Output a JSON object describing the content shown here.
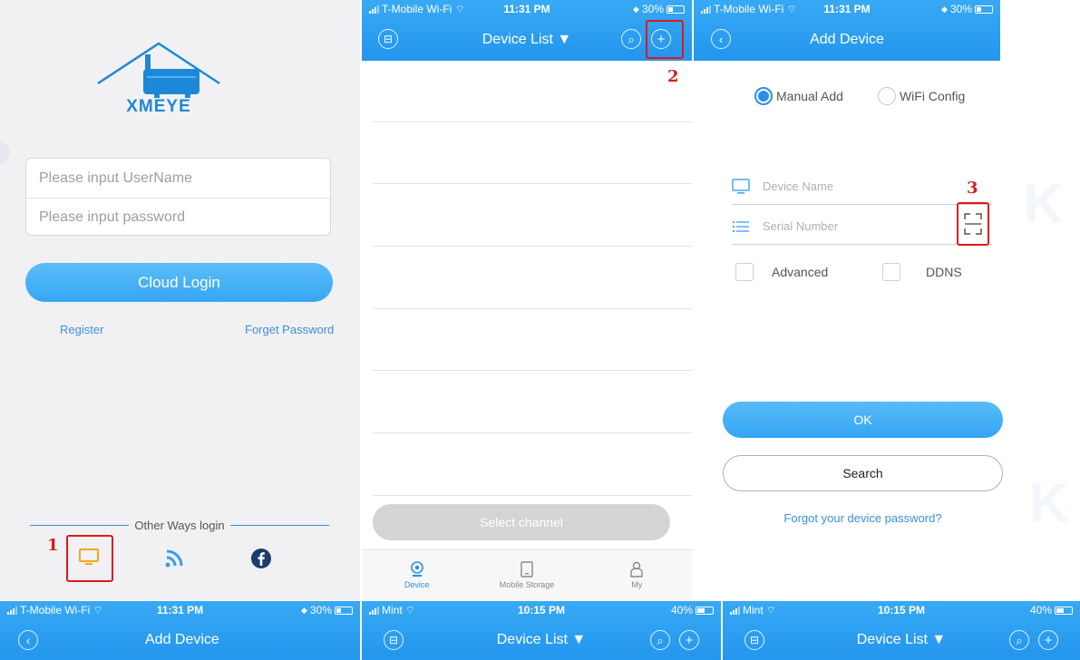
{
  "markers": {
    "one": "1",
    "two": "2",
    "three": "3"
  },
  "colors": {
    "brand_blue": "#2396ee",
    "link_blue": "#3c8fdc",
    "highlight_red": "#e01818"
  },
  "login": {
    "logo_text": "XMEYE",
    "username_placeholder": "Please input UserName",
    "password_placeholder": "Please input password",
    "cloud_login": "Cloud Login",
    "register": "Register",
    "forget_password": "Forget Password",
    "other_ways": "Other Ways login",
    "other_icons": [
      "local-device-icon",
      "wifi-signal-icon",
      "facebook-icon"
    ]
  },
  "device_list": {
    "status": {
      "carrier": "T-Mobile Wi-Fi",
      "time": "11:31 PM",
      "battery": "30%"
    },
    "title": "Device List ▼",
    "select_channel": "Select channel",
    "tabs": [
      {
        "label": "Device",
        "icon": "camera-icon"
      },
      {
        "label": "Mobile Storage",
        "icon": "tablet-icon"
      },
      {
        "label": "My",
        "icon": "person-icon"
      }
    ]
  },
  "add_device": {
    "status": {
      "carrier": "T-Mobile Wi-Fi",
      "time": "11:31 PM",
      "battery": "30%"
    },
    "title": "Add Device",
    "manual_add": "Manual Add",
    "wifi_config": "WiFi Config",
    "device_name_placeholder": "Device Name",
    "serial_number_placeholder": "Serial Number",
    "advanced": "Advanced",
    "ddns": "DDNS",
    "ok": "OK",
    "search": "Search",
    "forgot_password": "Forgot your device password?"
  },
  "bottom_panels": [
    {
      "carrier": "T-Mobile Wi-Fi",
      "time": "11:31 PM",
      "battery": "30%",
      "title": "Add Device"
    },
    {
      "carrier": "Mint",
      "time": "10:15 PM",
      "battery": "40%",
      "title": "Device List ▼"
    },
    {
      "carrier": "Mint",
      "time": "10:15 PM",
      "battery": "40%",
      "title": "Device List ▼"
    }
  ]
}
